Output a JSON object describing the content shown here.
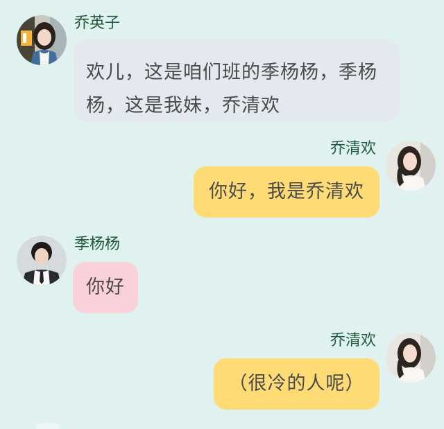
{
  "messages": [
    {
      "sender": "乔英子",
      "text": "欢儿，这是咱们班的季杨杨，季杨杨，这是我妹，乔清欢",
      "side": "left",
      "bubble_color": "#e4e8ef"
    },
    {
      "sender": "乔清欢",
      "text": "你好，我是乔清欢",
      "side": "right",
      "bubble_color": "#fedb75"
    },
    {
      "sender": "季杨杨",
      "text": "你好",
      "side": "left",
      "bubble_color": "#fad0db"
    },
    {
      "sender": "乔清欢",
      "text": "（很冷的人呢）",
      "side": "right",
      "bubble_color": "#fedb75"
    }
  ],
  "icons": {
    "avatar_yingzi": "girl-portrait-avatar",
    "avatar_qinghuan": "girl-portrait-avatar",
    "avatar_yangyang": "boy-portrait-avatar"
  },
  "colors": {
    "background": "#dff2ef",
    "name_text": "#1f5a3c",
    "message_text": "#4a4a4a"
  }
}
